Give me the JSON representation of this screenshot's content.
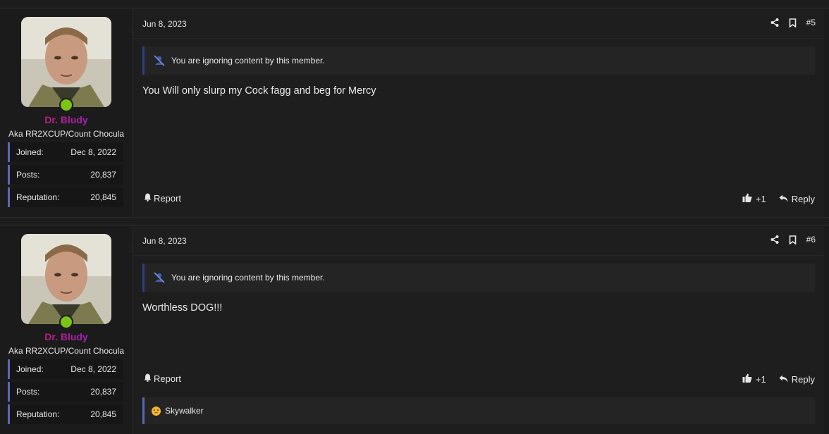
{
  "posts": [
    {
      "user": {
        "name": "Dr. Bludy",
        "title": "Aka RR2XCUP/Count Chocula",
        "stats": [
          {
            "label": "Joined:",
            "value": "Dec 8, 2022"
          },
          {
            "label": "Posts:",
            "value": "20,837"
          },
          {
            "label": "Reputation:",
            "value": "20,845"
          }
        ]
      },
      "date": "Jun 8, 2023",
      "number": "#5",
      "ignore_text": "You are ignoring content by this member.",
      "message": "You Will only slurp my Cock fagg and beg for Mercy",
      "report_label": "Report",
      "like_label": "+1",
      "reply_label": "Reply"
    },
    {
      "user": {
        "name": "Dr. Bludy",
        "title": "Aka RR2XCUP/Count Chocula",
        "stats": [
          {
            "label": "Joined:",
            "value": "Dec 8, 2022"
          },
          {
            "label": "Posts:",
            "value": "20,837"
          },
          {
            "label": "Reputation:",
            "value": "20,845"
          }
        ]
      },
      "date": "Jun 8, 2023",
      "number": "#6",
      "ignore_text": "You are ignoring content by this member.",
      "message": "Worthless DOG!!!",
      "report_label": "Report",
      "like_label": "+1",
      "reply_label": "Reply",
      "reaction_user": "Skywalker"
    }
  ],
  "colors": {
    "accent": "#5a67b8",
    "online": "#7cc414",
    "ignore_border": "#2f3f86"
  }
}
